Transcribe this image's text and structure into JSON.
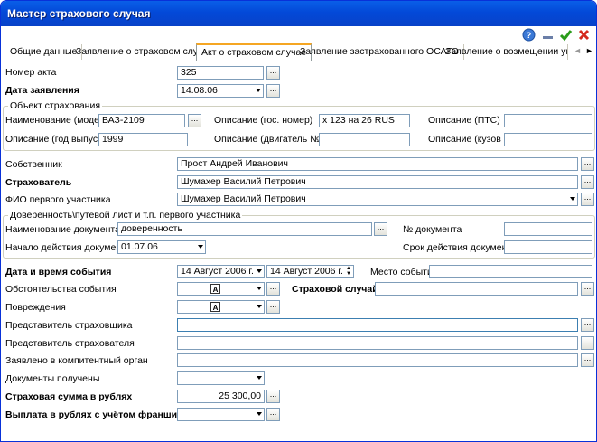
{
  "window": {
    "title": "Мастер страхового случая"
  },
  "tabs": [
    "Общие данные",
    "Заявление о страховом случае",
    "Акт о страховом случае",
    "Заявление застрахованного ОСАГО",
    "Заявление о возмещении ущерб"
  ],
  "fields": {
    "act_number": {
      "label": "Номер акта",
      "value": "325"
    },
    "application_date": {
      "label": "Дата заявления",
      "value": "14.08.06"
    },
    "insured_object": {
      "legend": "Объект страхования"
    },
    "model": {
      "label": "Наименование (модель)",
      "value": "ВАЗ-2109"
    },
    "gos_number": {
      "label": "Описание (гос. номер)",
      "value": "х 123 на 26 RUS"
    },
    "pts": {
      "label": "Описание (ПТС)",
      "value": ""
    },
    "year": {
      "label": "Описание (год выпуска)",
      "value": "1999"
    },
    "engine": {
      "label": "Описание (двигатель №)",
      "value": ""
    },
    "body": {
      "label": "Описание (кузов №)",
      "value": ""
    },
    "owner": {
      "label": "Собственник",
      "value": "Прост Андрей Иванович"
    },
    "insurant": {
      "label": "Страхователь",
      "value": "Шумахер Василий Петрович"
    },
    "first_participant": {
      "label": "ФИО первого участника",
      "value": "Шумахер Василий Петрович"
    },
    "power_of_attorney": {
      "legend": "Доверенность\\путевой лист и т.п. первого участника"
    },
    "doc_name": {
      "label": "Наименование документа",
      "value": "доверенность"
    },
    "doc_number": {
      "label": "№ документа",
      "value": ""
    },
    "doc_start": {
      "label": "Начало действия документа",
      "value": "01.07.06"
    },
    "doc_term": {
      "label": "Срок действия документа",
      "value": ""
    },
    "event_datetime": {
      "label": "Дата и время события",
      "date": "14 Август 2006 г.",
      "time": "14 Август 2006 г."
    },
    "event_place": {
      "label": "Место события",
      "value": ""
    },
    "circumstances": {
      "label": "Обстоятельства события",
      "value": ""
    },
    "insured_case": {
      "label": "Страховой случай",
      "value": ""
    },
    "damages": {
      "label": "Повреждения",
      "value": ""
    },
    "insurer_rep": {
      "label": "Представитель страховщика",
      "value": ""
    },
    "insurant_rep": {
      "label": "Представитель страхователя",
      "value": ""
    },
    "authority": {
      "label": "Заявлено в компитентный орган",
      "value": ""
    },
    "documents": {
      "label": "Документы получены",
      "value": ""
    },
    "insured_sum": {
      "label": "Страховая сумма в рублях",
      "value": "25 300,00"
    },
    "payout": {
      "label": "Выплата в рублях с учётом франшизы",
      "value": ""
    }
  },
  "glyphs": {
    "ellipsis": "...",
    "font_icon": "A",
    "close": "✕",
    "check": "✔",
    "help": "?",
    "minimize": "—",
    "tab_left": "◄",
    "tab_right": "►",
    "spin_up": "▲",
    "spin_down": "▼"
  },
  "colors": {
    "title_bar": "#0a5fe8",
    "field_border": "#7f9db9",
    "tab_highlight": "#f5a623"
  }
}
